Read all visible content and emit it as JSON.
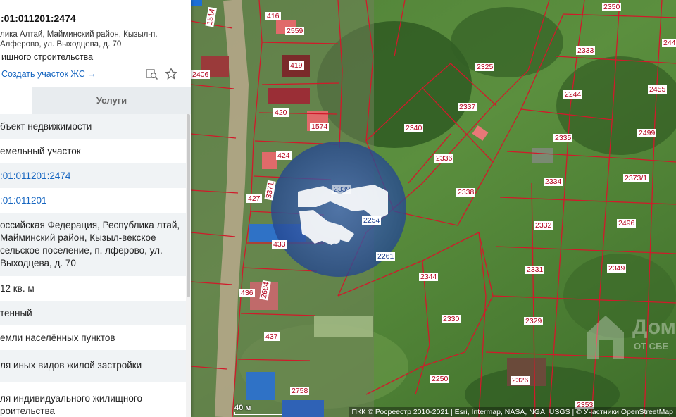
{
  "panel": {
    "cad_number": ":01:011201:2474",
    "address": "лика Алтай, Майминский район, Кызыл-п. Алферово, ул. Выходцева, д. 70",
    "purpose": "ищного строительства",
    "create_link": "Создать участок ЖС →",
    "icons": [
      "search-map-icon",
      "star-icon"
    ],
    "tab_services": "Услуги",
    "rows": [
      "бъект недвижимости",
      "емельный участок",
      ":01:011201:2474",
      ":01:011201",
      "оссийская Федерация, Республика лтай, Майминский район, Кызыл-векское сельское поселение, п. лферово, ул. Выходцева, д. 70",
      "12 кв. м",
      "тенный",
      "емли населённых пунктов",
      "ля иных видов жилой застройки",
      "ля индивидуального жилищного роительства"
    ]
  },
  "map": {
    "plots": [
      "1514",
      "416",
      "2559",
      "419",
      "2406",
      "420",
      "1574",
      "424",
      "3371",
      "427",
      "433",
      "436",
      "2684",
      "437",
      "2758",
      "2339",
      "2254",
      "2261",
      "2325",
      "2337",
      "2340",
      "2336",
      "2338",
      "2344",
      "2330",
      "2250",
      "2350",
      "2333",
      "244",
      "2244",
      "2455",
      "2335",
      "2499",
      "2334",
      "2373/1",
      "2332",
      "2496",
      "2331",
      "2349",
      "2329",
      "2326",
      "2353"
    ],
    "scale_label": "40 м",
    "attribution": "ПКК © Росреестр 2010-2021 | Esri, Intermap, NASA, NGA, USGS | © Участники OpenStreetMap",
    "watermark": [
      "Дом",
      "ОТ СБЕ"
    ]
  },
  "colors": {
    "accent": "#1c6fd6",
    "link": "#1565c0",
    "boundary": "#d01a2a",
    "badge": "#2a4d9b"
  }
}
